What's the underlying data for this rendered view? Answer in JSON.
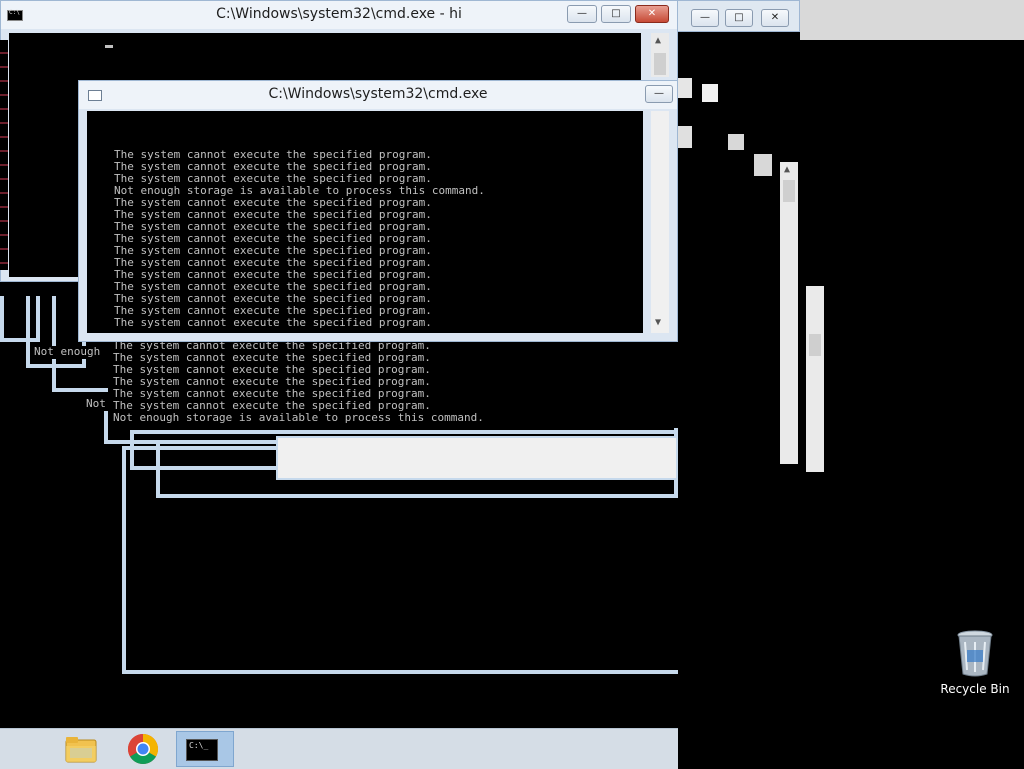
{
  "windows": {
    "back": {
      "title": "C:\\Windows\\system32\\cmd.exe - hi"
    },
    "front": {
      "title": "C:\\Windows\\system32\\cmd.exe",
      "lines": [
        "The system cannot execute the specified program.",
        "The system cannot execute the specified program.",
        "The system cannot execute the specified program.",
        "Not enough storage is available to process this command.",
        "The system cannot execute the specified program.",
        "The system cannot execute the specified program.",
        "The system cannot execute the specified program.",
        "The system cannot execute the specified program.",
        "The system cannot execute the specified program.",
        "The system cannot execute the specified program.",
        "The system cannot execute the specified program.",
        "The system cannot execute the specified program.",
        "The system cannot execute the specified program.",
        "The system cannot execute the specified program.",
        "The system cannot execute the specified program."
      ]
    },
    "echo": {
      "lines": [
        "The system cannot execute the specified program.",
        "The system cannot execute the specified program.",
        "The system cannot execute the specified program.",
        "The system cannot execute the specified program.",
        "The system cannot execute the specified program.",
        "The system cannot execute the specified program.",
        "Not enough storage is available to process this command."
      ]
    },
    "fragments": {
      "not_enough": "Not enough",
      "not": "Not"
    }
  },
  "desktop": {
    "recycle_bin_label": "Recycle Bin"
  },
  "taskbar": {
    "items": [
      {
        "name": "File Explorer",
        "icon": "folder-icon"
      },
      {
        "name": "Google Chrome",
        "icon": "chrome-icon"
      },
      {
        "name": "Command Prompt",
        "icon": "cmd-icon",
        "active": true
      }
    ]
  },
  "controls": {
    "minimize": "—",
    "maximize": "□",
    "close": "✕"
  },
  "colors": {
    "console_text": "#c0c0c0",
    "frame": "#dce6f2",
    "close_button": "#c74a36",
    "taskbar": "#d5dde6"
  }
}
